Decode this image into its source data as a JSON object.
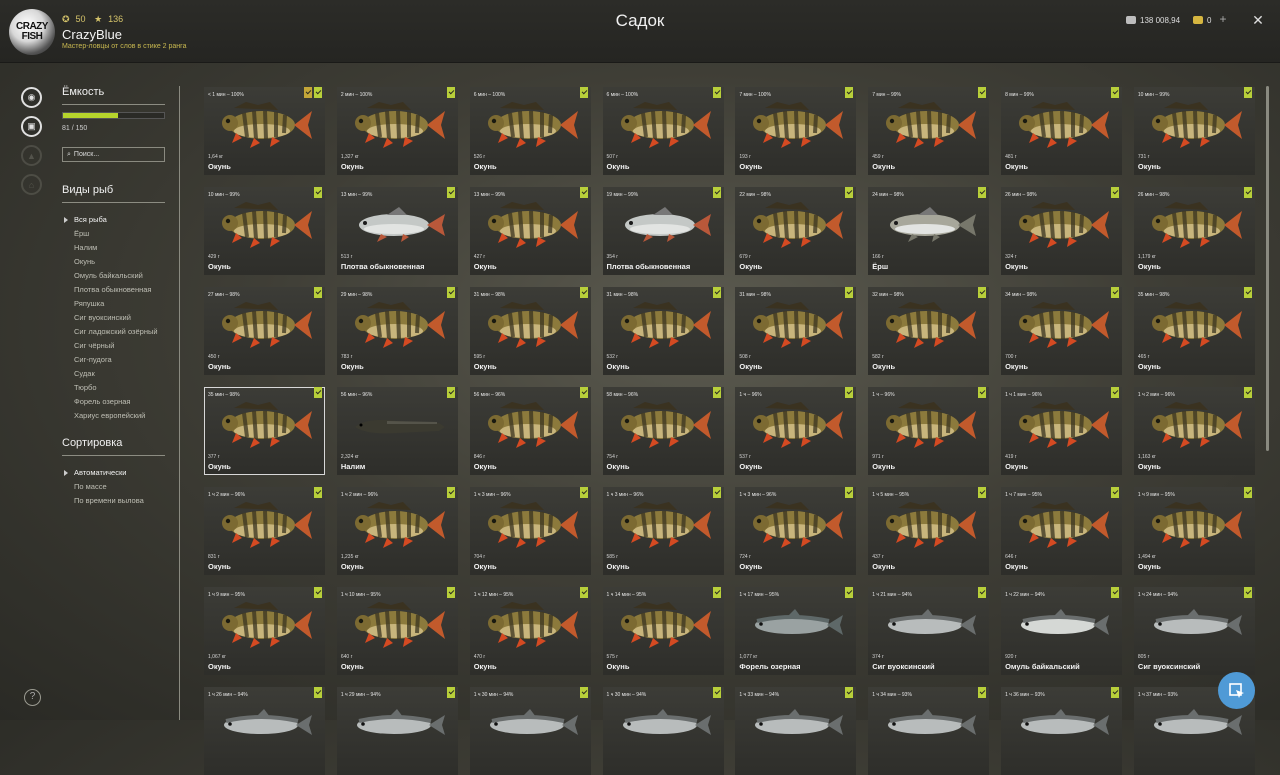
{
  "header": {
    "logo_text": "CRAZY FISH",
    "level": "50",
    "stars": "136",
    "username": "CrazyBlue",
    "subtitle": "Мастер-ловцы от слов в стике 2 ранга",
    "title": "Садок",
    "silver": "138 008,94",
    "gold": "0"
  },
  "sidebar": {
    "capacity_label": "Ёмкость",
    "capacity_value": "81 / 150",
    "capacity_fraction": 0.54,
    "search_placeholder": "Поиск...",
    "species_label": "Виды рыб",
    "species": [
      {
        "label": "Вся рыба",
        "active": true
      },
      {
        "label": "Ёрш"
      },
      {
        "label": "Налим"
      },
      {
        "label": "Окунь"
      },
      {
        "label": "Омуль байкальский"
      },
      {
        "label": "Плотва обыкновенная"
      },
      {
        "label": "Ряпушка"
      },
      {
        "label": "Сиг вуоксинский"
      },
      {
        "label": "Сиг ладожский озёрный"
      },
      {
        "label": "Сиг чёрный"
      },
      {
        "label": "Сиг-пудога"
      },
      {
        "label": "Судак"
      },
      {
        "label": "Тюрбо"
      },
      {
        "label": "Форель озерная"
      },
      {
        "label": "Хариус европейский"
      }
    ],
    "sort_label": "Сортировка",
    "sort": [
      {
        "label": "Автоматически",
        "active": true
      },
      {
        "label": "По массе"
      },
      {
        "label": "По времени вылова"
      }
    ]
  },
  "fish": [
    {
      "time": "< 1 мин – 100%",
      "weight": "1,64 кг",
      "name": "Окунь",
      "kind": "perch",
      "gold": true
    },
    {
      "time": "2 мин – 100%",
      "weight": "1,327 кг",
      "name": "Окунь",
      "kind": "perch"
    },
    {
      "time": "6 мин – 100%",
      "weight": "526 г",
      "name": "Окунь",
      "kind": "perch"
    },
    {
      "time": "6 мин – 100%",
      "weight": "507 г",
      "name": "Окунь",
      "kind": "perch"
    },
    {
      "time": "7 мин – 100%",
      "weight": "193 г",
      "name": "Окунь",
      "kind": "perch"
    },
    {
      "time": "7 мин – 99%",
      "weight": "459 г",
      "name": "Окунь",
      "kind": "perch"
    },
    {
      "time": "8 мин – 99%",
      "weight": "481 г",
      "name": "Окунь",
      "kind": "perch"
    },
    {
      "time": "10 мин – 99%",
      "weight": "731 г",
      "name": "Окунь",
      "kind": "perch"
    },
    {
      "time": "10 мин – 99%",
      "weight": "429 г",
      "name": "Окунь",
      "kind": "perch"
    },
    {
      "time": "13 мин – 99%",
      "weight": "513 г",
      "name": "Плотва обыкновенная",
      "kind": "roach"
    },
    {
      "time": "13 мин – 99%",
      "weight": "427 г",
      "name": "Окунь",
      "kind": "perch"
    },
    {
      "time": "19 мин – 99%",
      "weight": "354 г",
      "name": "Плотва обыкновенная",
      "kind": "roach"
    },
    {
      "time": "22 мин – 98%",
      "weight": "679 г",
      "name": "Окунь",
      "kind": "perch"
    },
    {
      "time": "24 мин – 98%",
      "weight": "166 г",
      "name": "Ёрш",
      "kind": "ruffe"
    },
    {
      "time": "26 мин – 98%",
      "weight": "324 г",
      "name": "Окунь",
      "kind": "perch"
    },
    {
      "time": "26 мин – 98%",
      "weight": "1,179 кг",
      "name": "Окунь",
      "kind": "perch"
    },
    {
      "time": "27 мин – 98%",
      "weight": "450 г",
      "name": "Окунь",
      "kind": "perch"
    },
    {
      "time": "29 мин – 98%",
      "weight": "783 г",
      "name": "Окунь",
      "kind": "perch"
    },
    {
      "time": "31 мин – 98%",
      "weight": "595 г",
      "name": "Окунь",
      "kind": "perch"
    },
    {
      "time": "31 мин – 98%",
      "weight": "532 г",
      "name": "Окунь",
      "kind": "perch"
    },
    {
      "time": "31 мин – 98%",
      "weight": "508 г",
      "name": "Окунь",
      "kind": "perch"
    },
    {
      "time": "32 мин – 98%",
      "weight": "582 г",
      "name": "Окунь",
      "kind": "perch"
    },
    {
      "time": "34 мин – 98%",
      "weight": "700 г",
      "name": "Окунь",
      "kind": "perch"
    },
    {
      "time": "35 мин – 98%",
      "weight": "465 г",
      "name": "Окунь",
      "kind": "perch"
    },
    {
      "time": "35 мин – 98%",
      "weight": "377 г",
      "name": "Окунь",
      "kind": "perch",
      "selected": true
    },
    {
      "time": "56 мин – 96%",
      "weight": "2,324 кг",
      "name": "Налим",
      "kind": "burbot"
    },
    {
      "time": "56 мин – 96%",
      "weight": "846 г",
      "name": "Окунь",
      "kind": "perch"
    },
    {
      "time": "58 мин – 96%",
      "weight": "754 г",
      "name": "Окунь",
      "kind": "perch"
    },
    {
      "time": "1 ч – 96%",
      "weight": "537 г",
      "name": "Окунь",
      "kind": "perch"
    },
    {
      "time": "1 ч – 96%",
      "weight": "971 г",
      "name": "Окунь",
      "kind": "perch"
    },
    {
      "time": "1 ч 1 мин – 96%",
      "weight": "419 г",
      "name": "Окунь",
      "kind": "perch"
    },
    {
      "time": "1 ч 2 мин – 96%",
      "weight": "1,163 кг",
      "name": "Окунь",
      "kind": "perch"
    },
    {
      "time": "1 ч 2 мин – 96%",
      "weight": "831 г",
      "name": "Окунь",
      "kind": "perch"
    },
    {
      "time": "1 ч 2 мин – 96%",
      "weight": "1,235 кг",
      "name": "Окунь",
      "kind": "perch"
    },
    {
      "time": "1 ч 3 мин – 96%",
      "weight": "704 г",
      "name": "Окунь",
      "kind": "perch"
    },
    {
      "time": "1 ч 3 мин – 96%",
      "weight": "585 г",
      "name": "Окунь",
      "kind": "perch"
    },
    {
      "time": "1 ч 3 мин – 96%",
      "weight": "724 г",
      "name": "Окунь",
      "kind": "perch"
    },
    {
      "time": "1 ч 5 мин – 95%",
      "weight": "437 г",
      "name": "Окунь",
      "kind": "perch"
    },
    {
      "time": "1 ч 7 мин – 95%",
      "weight": "646 г",
      "name": "Окунь",
      "kind": "perch"
    },
    {
      "time": "1 ч 9 мин – 95%",
      "weight": "1,494 кг",
      "name": "Окунь",
      "kind": "perch"
    },
    {
      "time": "1 ч 9 мин – 95%",
      "weight": "1,067 кг",
      "name": "Окунь",
      "kind": "perch"
    },
    {
      "time": "1 ч 10 мин – 95%",
      "weight": "640 г",
      "name": "Окунь",
      "kind": "perch"
    },
    {
      "time": "1 ч 12 мин – 95%",
      "weight": "470 г",
      "name": "Окунь",
      "kind": "perch"
    },
    {
      "time": "1 ч 14 мин – 95%",
      "weight": "575 г",
      "name": "Окунь",
      "kind": "perch"
    },
    {
      "time": "1 ч 17 мин – 95%",
      "weight": "1,077 кг",
      "name": "Форель озерная",
      "kind": "trout"
    },
    {
      "time": "1 ч 21 мин – 94%",
      "weight": "374 г",
      "name": "Сиг вуоксинский",
      "kind": "whitefish"
    },
    {
      "time": "1 ч 22 мин – 94%",
      "weight": "920 г",
      "name": "Омуль байкальский",
      "kind": "omul"
    },
    {
      "time": "1 ч 24 мин – 94%",
      "weight": "805 г",
      "name": "Сиг вуоксинский",
      "kind": "whitefish"
    },
    {
      "time": "1 ч 26 мин – 94%",
      "weight": "",
      "name": "",
      "kind": "whitefish"
    },
    {
      "time": "1 ч 29 мин – 94%",
      "weight": "",
      "name": "",
      "kind": "whitefish"
    },
    {
      "time": "1 ч 30 мин – 94%",
      "weight": "",
      "name": "",
      "kind": "whitefish"
    },
    {
      "time": "1 ч 30 мин – 94%",
      "weight": "",
      "name": "",
      "kind": "whitefish"
    },
    {
      "time": "1 ч 33 мин – 94%",
      "weight": "",
      "name": "",
      "kind": "whitefish"
    },
    {
      "time": "1 ч 34 мин – 93%",
      "weight": "",
      "name": "",
      "kind": "whitefish"
    },
    {
      "time": "1 ч 36 мин – 93%",
      "weight": "",
      "name": "",
      "kind": "whitefish"
    },
    {
      "time": "1 ч 37 мин – 93%",
      "weight": "",
      "name": "",
      "kind": "whitefish"
    }
  ]
}
